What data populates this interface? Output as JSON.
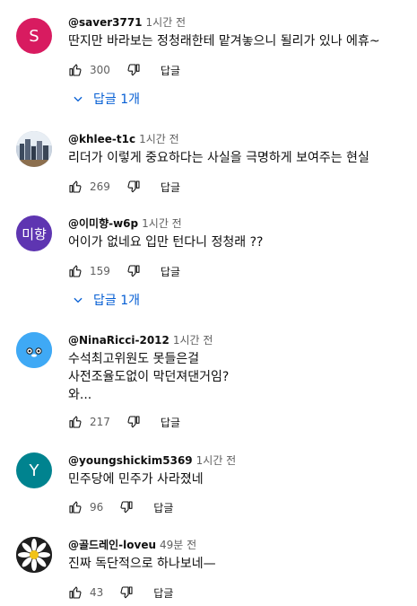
{
  "comments": [
    {
      "author": "@saver3771",
      "time": "1시간 전",
      "text": [
        "딴지만 바라보는 정청래한테 맡겨놓으니 될리가 있나 에휴~"
      ],
      "likes": "300",
      "reply_label": "답글",
      "replies_label": "답글 1개",
      "avatar": {
        "type": "letter",
        "letter": "S",
        "color": "#d81b60"
      }
    },
    {
      "author": "@khlee-t1c",
      "time": "1시간 전",
      "text": [
        "리더가 이렇게 중요하다는 사실을 극명하게 보여주는 현실"
      ],
      "likes": "269",
      "reply_label": "답글",
      "avatar": {
        "type": "photo",
        "icon": "city-photo-avatar"
      }
    },
    {
      "author": "@이미향-w6p",
      "time": "1시간 전",
      "text": [
        "어이가 없네요 입만 턴다니 정청래 ??"
      ],
      "likes": "159",
      "reply_label": "답글",
      "replies_label": "답글 1개",
      "avatar": {
        "type": "letter",
        "letter": "미향",
        "color": "#5e35b1"
      }
    },
    {
      "author": "@NinaRicci-2012",
      "time": "1시간 전",
      "text": [
        "수석최고위원도 못들은걸",
        "사전조율도없이 막던져댄거임?",
        "와..."
      ],
      "likes": "217",
      "reply_label": "답글",
      "avatar": {
        "type": "mascot",
        "icon": "cute-face-avatar",
        "color": "#3fa9f5"
      }
    },
    {
      "author": "@youngshickim5369",
      "time": "1시간 전",
      "text": [
        "민주당에 민주가 사라졌네"
      ],
      "likes": "96",
      "reply_label": "답글",
      "avatar": {
        "type": "letter",
        "letter": "Y",
        "color": "#00838f"
      }
    },
    {
      "author": "@골드레인-loveu",
      "time": "49분 전",
      "text": [
        "진짜 독단적으로 하나보네—"
      ],
      "likes": "43",
      "reply_label": "답글",
      "avatar": {
        "type": "flower",
        "icon": "daisy-avatar"
      }
    }
  ],
  "colors": {
    "link_blue": "#065fd4",
    "secondary_text": "#606060"
  }
}
